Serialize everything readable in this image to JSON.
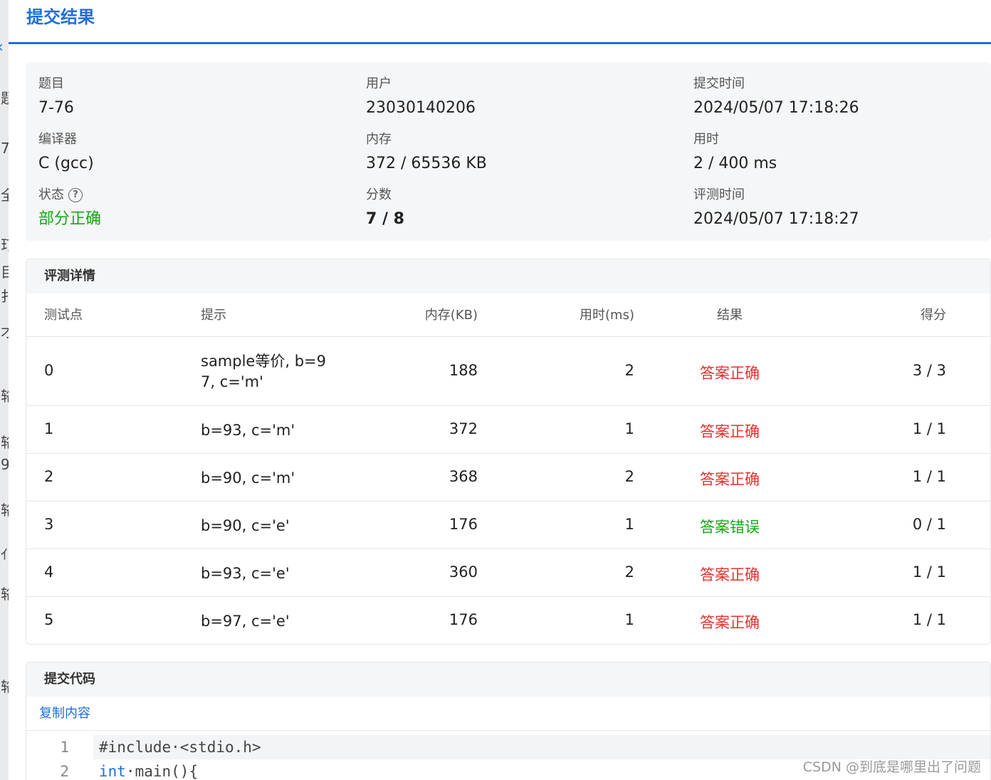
{
  "panel": {
    "title": "提交结果"
  },
  "left_fragments": [
    "题",
    "7",
    "全",
    "玎",
    "目",
    "扌",
    "才",
    "辂",
    "辂",
    "9",
    "辂",
    "ｲ",
    "辂",
    "辂"
  ],
  "info": {
    "problem": {
      "label": "题目",
      "value": "7-76"
    },
    "user": {
      "label": "用户",
      "value": "23030140206"
    },
    "submit_time": {
      "label": "提交时间",
      "value": "2024/05/07 17:18:26"
    },
    "compiler": {
      "label": "编译器",
      "value": "C (gcc)"
    },
    "memory": {
      "label": "内存",
      "value": "372 / 65536 KB"
    },
    "time_used": {
      "label": "用时",
      "value": "2 / 400 ms"
    },
    "status": {
      "label": "状态",
      "value": "部分正确"
    },
    "score": {
      "label": "分数",
      "value": "7 / 8"
    },
    "judge_time": {
      "label": "评测时间",
      "value": "2024/05/07 17:18:27"
    }
  },
  "details": {
    "title": "评测详情",
    "columns": [
      "测试点",
      "提示",
      "内存(KB)",
      "用时(ms)",
      "结果",
      "得分"
    ],
    "rows": [
      {
        "case": "0",
        "hint": [
          "sample等价, b=9",
          "7, c='m'"
        ],
        "memory": "188",
        "time": "2",
        "result": "答案正确",
        "score": "3 / 3"
      },
      {
        "case": "1",
        "hint": [
          "b=93, c='m'"
        ],
        "memory": "372",
        "time": "1",
        "result": "答案正确",
        "score": "1 / 1"
      },
      {
        "case": "2",
        "hint": [
          "b=90, c='m'"
        ],
        "memory": "368",
        "time": "2",
        "result": "答案正确",
        "score": "1 / 1"
      },
      {
        "case": "3",
        "hint": [
          "b=90, c='e'"
        ],
        "memory": "176",
        "time": "1",
        "result": "答案错误",
        "score": "0 / 1"
      },
      {
        "case": "4",
        "hint": [
          "b=93, c='e'"
        ],
        "memory": "360",
        "time": "2",
        "result": "答案正确",
        "score": "1 / 1"
      },
      {
        "case": "5",
        "hint": [
          "b=97, c='e'"
        ],
        "memory": "176",
        "time": "1",
        "result": "答案正确",
        "score": "1 / 1"
      }
    ]
  },
  "code": {
    "title": "提交代码",
    "copy_label": "复制内容",
    "lines": [
      {
        "num": "1",
        "parts": [
          {
            "t": "#include·<stdio.h>",
            "kw": false
          }
        ]
      },
      {
        "num": "2",
        "parts": [
          {
            "t": "int",
            "kw": true
          },
          {
            "t": "·main(){",
            "kw": false
          }
        ]
      }
    ]
  },
  "colors": {
    "accent": "#1f6fd6",
    "correct_red": "#ea2f2f",
    "wrong_green": "#15a815",
    "partial_green": "#15a815"
  },
  "watermark": "CSDN @到底是哪里出了问题"
}
